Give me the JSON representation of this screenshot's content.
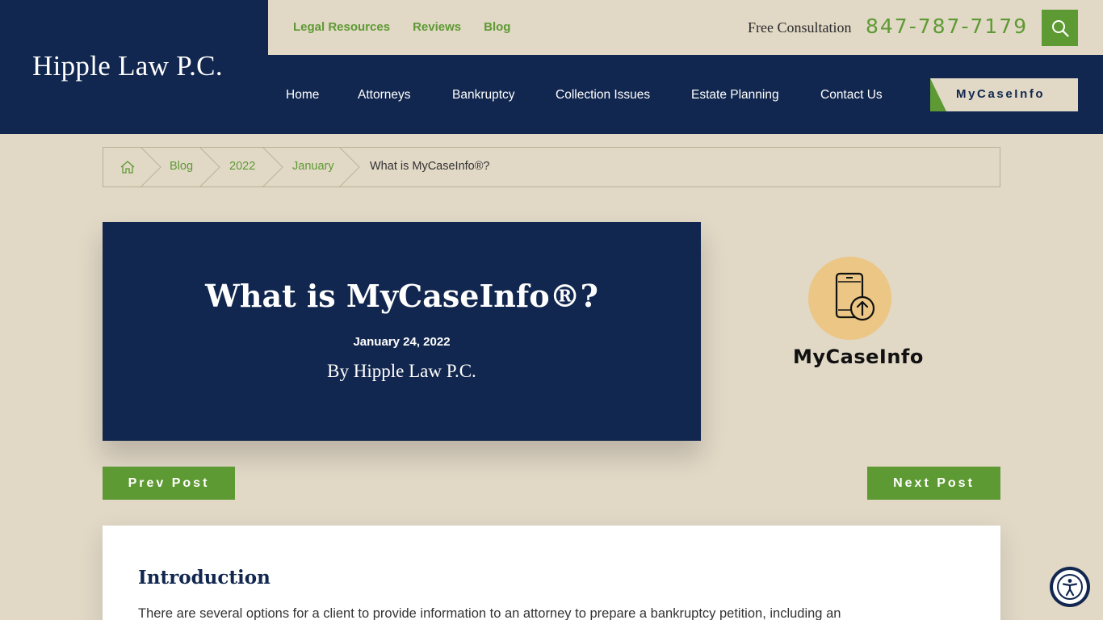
{
  "site": {
    "logo": "Hipple Law P.C."
  },
  "utility": {
    "links": [
      "Legal Resources",
      "Reviews",
      "Blog"
    ],
    "consult_label": "Free Consultation",
    "phone": "847-787-7179"
  },
  "nav": {
    "items": [
      "Home",
      "Attorneys",
      "Bankruptcy",
      "Collection Issues",
      "Estate Planning",
      "Contact Us"
    ],
    "cta": "MyCaseInfo"
  },
  "breadcrumb": {
    "items": [
      "Blog",
      "2022",
      "January"
    ],
    "current": "What is MyCaseInfo®?"
  },
  "post": {
    "title": "What is MyCaseInfo®?",
    "date": "January 24, 2022",
    "author": "By Hipple Law P.C.",
    "image_label": "MyCaseInfo"
  },
  "pager": {
    "prev": "Prev Post",
    "next": "Next Post"
  },
  "article": {
    "heading": "Introduction",
    "text": "There are several options for a client to provide information to an attorney to prepare a bankruptcy petition, including an"
  },
  "colors": {
    "navy": "#12274f",
    "green": "#5e9a33",
    "beige": "#e1d8c6",
    "peach": "#ecc684"
  }
}
